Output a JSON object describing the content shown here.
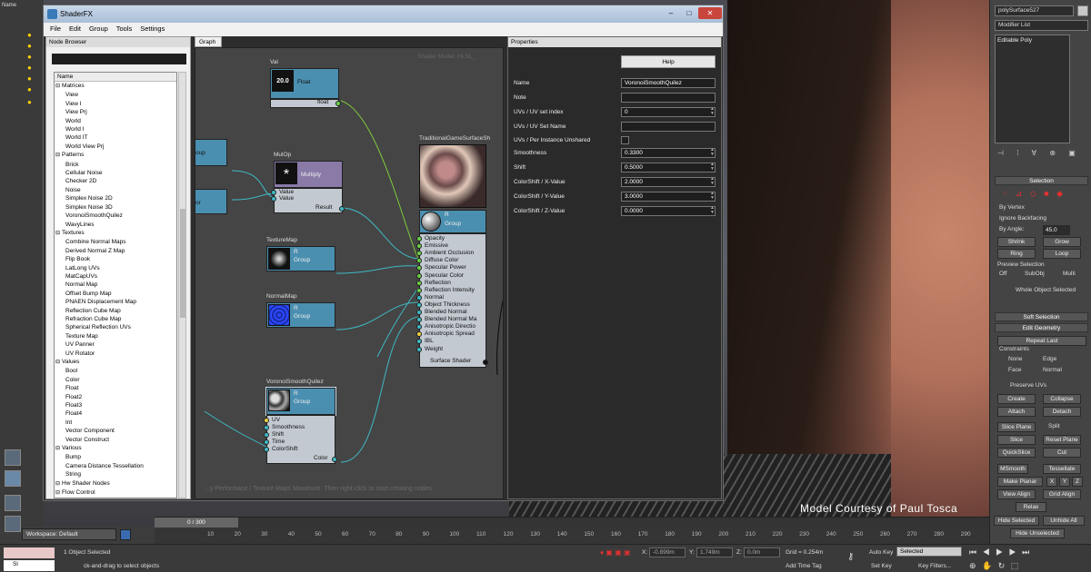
{
  "viewport": {
    "credit": "Model Courtesy of Paul Tosca",
    "corner_label": "Name"
  },
  "shaderfx": {
    "title": "ShaderFX",
    "window_buttons": [
      "–",
      "□",
      "✕"
    ],
    "menu": [
      "File",
      "Edit",
      "Group",
      "Tools",
      "Settings"
    ],
    "node_browser": {
      "title": "Node Browser",
      "column": "Name",
      "tree": [
        {
          "label": "Matrices",
          "type": "cat"
        },
        {
          "label": "View",
          "type": "leaf"
        },
        {
          "label": "View I",
          "type": "leaf"
        },
        {
          "label": "View Prj",
          "type": "leaf"
        },
        {
          "label": "World",
          "type": "leaf"
        },
        {
          "label": "World I",
          "type": "leaf"
        },
        {
          "label": "World IT",
          "type": "leaf"
        },
        {
          "label": "World View Prj",
          "type": "leaf"
        },
        {
          "label": "Patterns",
          "type": "cat"
        },
        {
          "label": "Brick",
          "type": "leaf"
        },
        {
          "label": "Cellular Noise",
          "type": "leaf"
        },
        {
          "label": "Checker 2D",
          "type": "leaf"
        },
        {
          "label": "Noise",
          "type": "leaf"
        },
        {
          "label": "Simplex Noise 2D",
          "type": "leaf"
        },
        {
          "label": "Simplex Noise 3D",
          "type": "leaf"
        },
        {
          "label": "VoronoiSmoothQuilez",
          "type": "leaf"
        },
        {
          "label": "WavyLines",
          "type": "leaf"
        },
        {
          "label": "Textures",
          "type": "cat"
        },
        {
          "label": "Combine Normal Maps",
          "type": "leaf"
        },
        {
          "label": "Derived Normal Z Map",
          "type": "leaf"
        },
        {
          "label": "Flip Book",
          "type": "leaf"
        },
        {
          "label": "LatLong UVs",
          "type": "leaf"
        },
        {
          "label": "MatCapUVs",
          "type": "leaf"
        },
        {
          "label": "Normal Map",
          "type": "leaf"
        },
        {
          "label": "Offset Bump Map",
          "type": "leaf"
        },
        {
          "label": "PNAEN Displacement Map",
          "type": "leaf"
        },
        {
          "label": "Reflection Cube Map",
          "type": "leaf"
        },
        {
          "label": "Refraction Cube Map",
          "type": "leaf"
        },
        {
          "label": "Spherical Reflection UVs",
          "type": "leaf"
        },
        {
          "label": "Texture Map",
          "type": "leaf"
        },
        {
          "label": "UV Panner",
          "type": "leaf"
        },
        {
          "label": "UV Rotator",
          "type": "leaf"
        },
        {
          "label": "Values",
          "type": "cat"
        },
        {
          "label": "Bool",
          "type": "leaf"
        },
        {
          "label": "Color",
          "type": "leaf"
        },
        {
          "label": "Float",
          "type": "leaf"
        },
        {
          "label": "Float2",
          "type": "leaf"
        },
        {
          "label": "Float3",
          "type": "leaf"
        },
        {
          "label": "Float4",
          "type": "leaf"
        },
        {
          "label": "Int",
          "type": "leaf"
        },
        {
          "label": "Vector Component",
          "type": "leaf"
        },
        {
          "label": "Vector Construct",
          "type": "leaf"
        },
        {
          "label": "Various",
          "type": "cat"
        },
        {
          "label": "Bump",
          "type": "leaf"
        },
        {
          "label": "Camera Distance Tessellation",
          "type": "leaf"
        },
        {
          "label": "String",
          "type": "leaf"
        },
        {
          "label": "Hw Shader Nodes",
          "type": "cat"
        },
        {
          "label": "Flow Control",
          "type": "cat"
        }
      ]
    },
    "graph": {
      "tab": "Graph",
      "shader_model": "Shader Model: HLSL_",
      "hint": "...y Performace / Texture Maps Maximum. Then right-click to start creating nodes.",
      "nodes": {
        "val": {
          "title": "Val",
          "value": "20.0",
          "type": "Float",
          "out": "float"
        },
        "mulop": {
          "title": "MulOp",
          "symbol": "*",
          "type": "Multiply",
          "in1": "Value",
          "in2": "Value",
          "out": "Result"
        },
        "texturemap": {
          "title": "TextureMap",
          "r": "R",
          "type": "Group"
        },
        "normalmap": {
          "title": "NormalMap",
          "r": "R",
          "type": "Group"
        },
        "voronoi": {
          "title": "VoronoiSmoothQuilez",
          "r": "R",
          "type": "Group",
          "inputs": [
            "UV",
            "Smoothness",
            "Shift",
            "Time",
            "ColorShift"
          ],
          "out": "Color"
        },
        "left1": {
          "type": "oup"
        },
        "left2": {
          "type": "or"
        },
        "surface": {
          "title": "TraditionalGameSurfaceSh",
          "r": "R",
          "type": "Group",
          "inputs": [
            "Opacity",
            "Emissive",
            "Ambient Occlusion",
            "Diffuse Color",
            "Specular Power",
            "Specular Color",
            "Reflection",
            "Reflection Intensity",
            "Normal",
            "Object Thickness",
            "Blended Normal",
            "Blended Normal Ma",
            "Anisotropic Directio",
            "Anisotropic Spread",
            "IBL",
            "Weight"
          ],
          "out": "Surface Shader"
        }
      }
    },
    "properties": {
      "title": "Properties",
      "help": "Help",
      "rows": [
        {
          "label": "Name",
          "value": "VoronoiSmoothQuilez",
          "kind": "field"
        },
        {
          "label": "Note",
          "value": "",
          "kind": "field"
        },
        {
          "label": "UVs / UV set index",
          "value": "0",
          "kind": "spin"
        },
        {
          "label": "UVs / UV Set Name",
          "value": "",
          "kind": "field"
        },
        {
          "label": "UVs / Per Instance Unshared",
          "value": "",
          "kind": "check"
        },
        {
          "label": "Smoothness",
          "value": "0.3300",
          "kind": "spin"
        },
        {
          "label": "Shift",
          "value": "0.5000",
          "kind": "spin"
        },
        {
          "label": "ColorShift / X-Value",
          "value": "2.0000",
          "kind": "spin"
        },
        {
          "label": "ColorShift / Y-Value",
          "value": "3.0000",
          "kind": "spin"
        },
        {
          "label": "ColorShift / Z-Value",
          "value": "0.0000",
          "kind": "spin"
        }
      ]
    }
  },
  "command_panel": {
    "object_name": "polySurface527",
    "modifier_list": "Modifier List",
    "stack_item": "Editable Poly",
    "selection": {
      "title": "Selection",
      "by_vertex": "By Vertex",
      "ignore_backfacing": "Ignore Backfacing",
      "by_angle": "By Angle:",
      "angle": "45.0",
      "shrink": "Shrink",
      "grow": "Grow",
      "ring": "Ring",
      "loop": "Loop",
      "preview": "Preview Selection",
      "off": "Off",
      "subobj": "SubObj",
      "multi": "Multi",
      "whole": "Whole Object Selected"
    },
    "soft_selection": "Soft Selection",
    "edit_geometry": {
      "title": "Edit Geometry",
      "repeat_last": "Repeat Last",
      "constraints": "Constraints",
      "none": "None",
      "edge": "Edge",
      "face": "Face",
      "normal": "Normal",
      "preserve_uvs": "Preserve UVs",
      "create": "Create",
      "collapse": "Collapse",
      "attach": "Attach",
      "detach": "Detach",
      "slice_plane": "Slice Plane",
      "split": "Split",
      "slice": "Slice",
      "reset_plane": "Reset Plane",
      "quickslice": "QuickSlice",
      "cut": "Cut",
      "msmooth": "MSmooth",
      "tessellate": "Tessellate",
      "make_planar": "Make Planar",
      "x": "X",
      "y": "Y",
      "z": "Z",
      "view_align": "View Align",
      "grid_align": "Grid Align",
      "relax": "Relax",
      "hide_selected": "Hide Selected",
      "unhide_all": "Unhide All",
      "hide_unselected": "Hide Unselected"
    }
  },
  "bottom": {
    "workspace": "Workspace: Default",
    "timeline": "0 / 300",
    "ticks": [
      "10",
      "20",
      "30",
      "40",
      "50",
      "60",
      "70",
      "80",
      "90",
      "100",
      "110",
      "120",
      "130",
      "140",
      "150",
      "160",
      "170",
      "180",
      "190",
      "200",
      "210",
      "220",
      "230",
      "240",
      "250",
      "260",
      "270",
      "280",
      "290"
    ],
    "status": "1 Object Selected",
    "prompt": "ck-and-drag to select objects",
    "script_label": "Sl",
    "x_label": "X:",
    "x": "-0.899m",
    "y_label": "Y:",
    "y": "1.749m",
    "z_label": "Z:",
    "z": "0.0m",
    "grid": "Grid = 0.254m",
    "add_time_tag": "Add Time Tag",
    "auto_key": "Auto Key",
    "selected": "Selected",
    "set_key": "Set Key",
    "key_filters": "Key Filters..."
  }
}
